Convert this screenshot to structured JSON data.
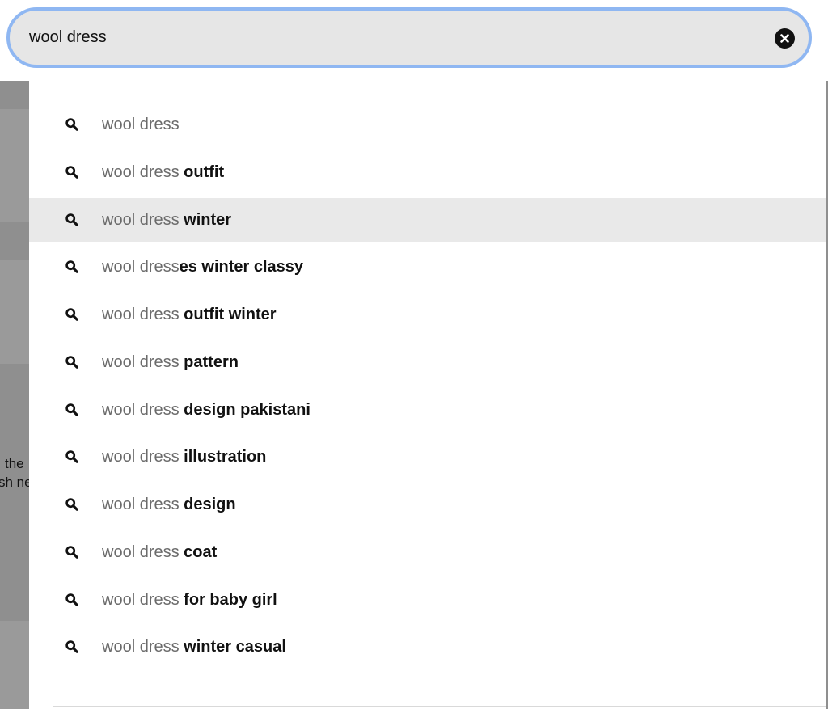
{
  "search": {
    "value": "wool dress",
    "clear_icon": "close-circle-icon"
  },
  "backdrop": {
    "fragments": [
      "the",
      "sh ne"
    ]
  },
  "suggestions": [
    {
      "base": "wool dress",
      "suffix": "",
      "icon": "search-icon",
      "highlighted": false
    },
    {
      "base": "wool dress",
      "suffix": " outfit",
      "icon": "search-icon",
      "highlighted": false
    },
    {
      "base": "wool dress",
      "suffix": " winter",
      "icon": "search-icon",
      "highlighted": true
    },
    {
      "base": "wool dress",
      "suffix": "es winter classy",
      "icon": "search-icon",
      "highlighted": false
    },
    {
      "base": "wool dress",
      "suffix": " outfit winter",
      "icon": "search-icon",
      "highlighted": false
    },
    {
      "base": "wool dress",
      "suffix": " pattern",
      "icon": "search-icon",
      "highlighted": false
    },
    {
      "base": "wool dress",
      "suffix": " design pakistani",
      "icon": "search-icon",
      "highlighted": false
    },
    {
      "base": "wool dress",
      "suffix": " illustration",
      "icon": "search-icon",
      "highlighted": false
    },
    {
      "base": "wool dress",
      "suffix": " design",
      "icon": "search-icon",
      "highlighted": false
    },
    {
      "base": "wool dress",
      "suffix": " coat",
      "icon": "search-icon",
      "highlighted": false
    },
    {
      "base": "wool dress",
      "suffix": " for baby girl",
      "icon": "search-icon",
      "highlighted": false
    },
    {
      "base": "wool dress",
      "suffix": " winter casual",
      "icon": "search-icon",
      "highlighted": false
    }
  ],
  "colors": {
    "focus_ring": "#8fb7f2",
    "highlight_row": "#e9e9e9",
    "base_text": "#6b6b6b",
    "bold_text": "#111111"
  }
}
